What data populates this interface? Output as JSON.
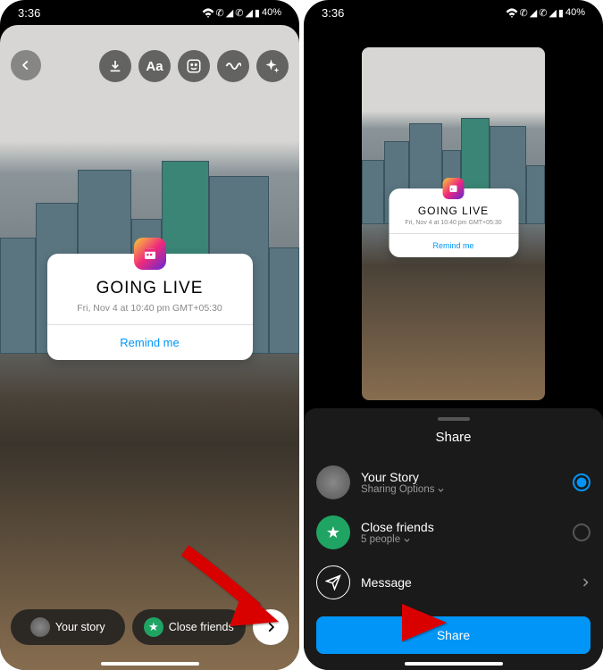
{
  "status": {
    "time": "3:36",
    "battery": "40%"
  },
  "tools": {
    "text": "Aa"
  },
  "sticker": {
    "title": "GOING LIVE",
    "subtitle": "Fri, Nov 4 at 10:40 pm GMT+05:30",
    "action": "Remind me"
  },
  "bottom": {
    "your_story": "Your story",
    "close_friends": "Close friends"
  },
  "sheet": {
    "title": "Share",
    "your_story": {
      "title": "Your Story",
      "sub": "Sharing Options"
    },
    "close_friends": {
      "title": "Close friends",
      "sub": "5 people"
    },
    "message": {
      "title": "Message"
    },
    "share_btn": "Share"
  }
}
